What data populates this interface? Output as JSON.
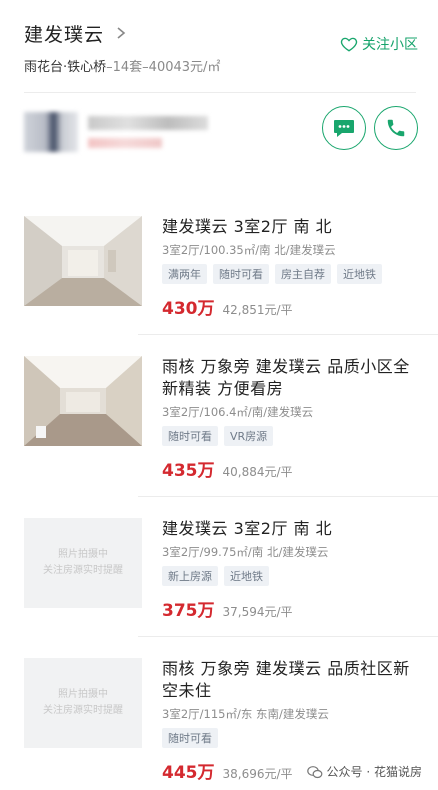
{
  "header": {
    "community_name": "建发璞云",
    "follow_label": "关注小区",
    "district": "雨花台·铁心桥",
    "meta": "–14套–40043元/㎡"
  },
  "listings": [
    {
      "title": "建发璞云 3室2厅 南 北",
      "desc": "3室2厅/100.35㎡/南 北/建发璞云",
      "tags": [
        "满两年",
        "随时可看",
        "房主自荐",
        "近地铁"
      ],
      "price": "430万",
      "unit_price": "42,851元/平",
      "has_photo": true
    },
    {
      "title": "雨核 万象旁 建发璞云 品质小区全新精装 方便看房",
      "desc": "3室2厅/106.4㎡/南/建发璞云",
      "tags": [
        "随时可看",
        "VR房源"
      ],
      "price": "435万",
      "unit_price": "40,884元/平",
      "has_photo": true
    },
    {
      "title": "建发璞云 3室2厅 南 北",
      "desc": "3室2厅/99.75㎡/南 北/建发璞云",
      "tags": [
        "新上房源",
        "近地铁"
      ],
      "price": "375万",
      "unit_price": "37,594元/平",
      "has_photo": false,
      "placeholder_line1": "照片拍摄中",
      "placeholder_line2": "关注房源实时提醒"
    },
    {
      "title": "雨核 万象旁 建发璞云 品质社区新空未住",
      "desc": "3室2厅/115㎡/东 东南/建发璞云",
      "tags": [
        "随时可看"
      ],
      "price": "445万",
      "unit_price": "38,696元/平",
      "has_photo": false,
      "placeholder_line1": "照片拍摄中",
      "placeholder_line2": "关注房源实时提醒"
    }
  ],
  "watermark": {
    "text": "公众号 · 花猫说房"
  },
  "colors": {
    "accent": "#19a66d",
    "price": "#d4292f"
  }
}
